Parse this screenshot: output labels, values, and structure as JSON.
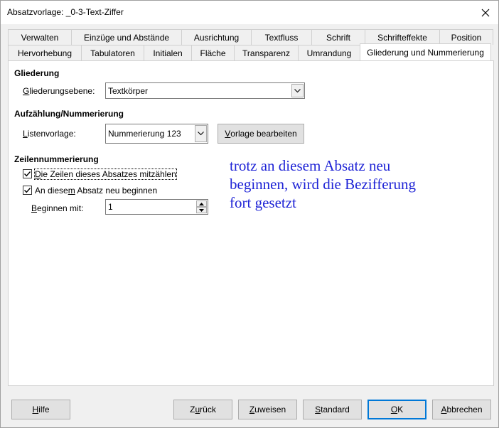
{
  "window": {
    "title": "Absatzvorlage: _0-3-Text-Ziffer"
  },
  "tabs": {
    "back_row": [
      {
        "label": "Verwalten"
      },
      {
        "label": "Einzüge und Abstände"
      },
      {
        "label": "Ausrichtung"
      },
      {
        "label": "Textfluss"
      },
      {
        "label": "Schrift"
      },
      {
        "label": "Schrifteffekte"
      },
      {
        "label": "Position"
      }
    ],
    "front_row": [
      {
        "label": "Hervorhebung"
      },
      {
        "label": "Tabulatoren"
      },
      {
        "label": "Initialen"
      },
      {
        "label": "Fläche"
      },
      {
        "label": "Transparenz"
      },
      {
        "label": "Umrandung"
      },
      {
        "label": "Gliederung und Nummerierung",
        "active": true
      }
    ]
  },
  "outline": {
    "heading": "Gliederung",
    "level_label_pre": "",
    "level_label_mn": "G",
    "level_label_post": "liederungsebene:",
    "level_value": "Textkörper"
  },
  "numbering": {
    "heading": "Aufzählung/Nummerierung",
    "list_label_mn": "L",
    "list_label_post": "istenvorlage:",
    "list_value": "Nummerierung 123",
    "edit_button_mn": "V",
    "edit_button_post": "orlage bearbeiten"
  },
  "line_numbering": {
    "heading": "Zeilennummerierung",
    "count_lines_mn": "D",
    "count_lines_post": "ie Zeilen dieses Absatzes mitzählen",
    "count_lines_checked": true,
    "restart_pre": "An diese",
    "restart_mn": "m",
    "restart_post": " Absatz neu beginnen",
    "restart_checked": true,
    "start_label_mn": "B",
    "start_label_post": "eginnen mit:",
    "start_value": "1"
  },
  "annotation": {
    "line1": "trotz an diesem Absatz neu",
    "line2": "beginnen, wird die Bezifferung",
    "line3": "fort gesetzt",
    "color": "#1f24d6"
  },
  "footer": {
    "help_mn": "H",
    "help_post": "ilfe",
    "back_pre": "Z",
    "back_mn": "u",
    "back_post": "rück",
    "assign_mn": "Z",
    "assign_post": "uweisen",
    "standard_mn": "S",
    "standard_post": "tandard",
    "ok_mn": "O",
    "ok_post": "K",
    "cancel_mn": "A",
    "cancel_post": "bbrechen"
  }
}
